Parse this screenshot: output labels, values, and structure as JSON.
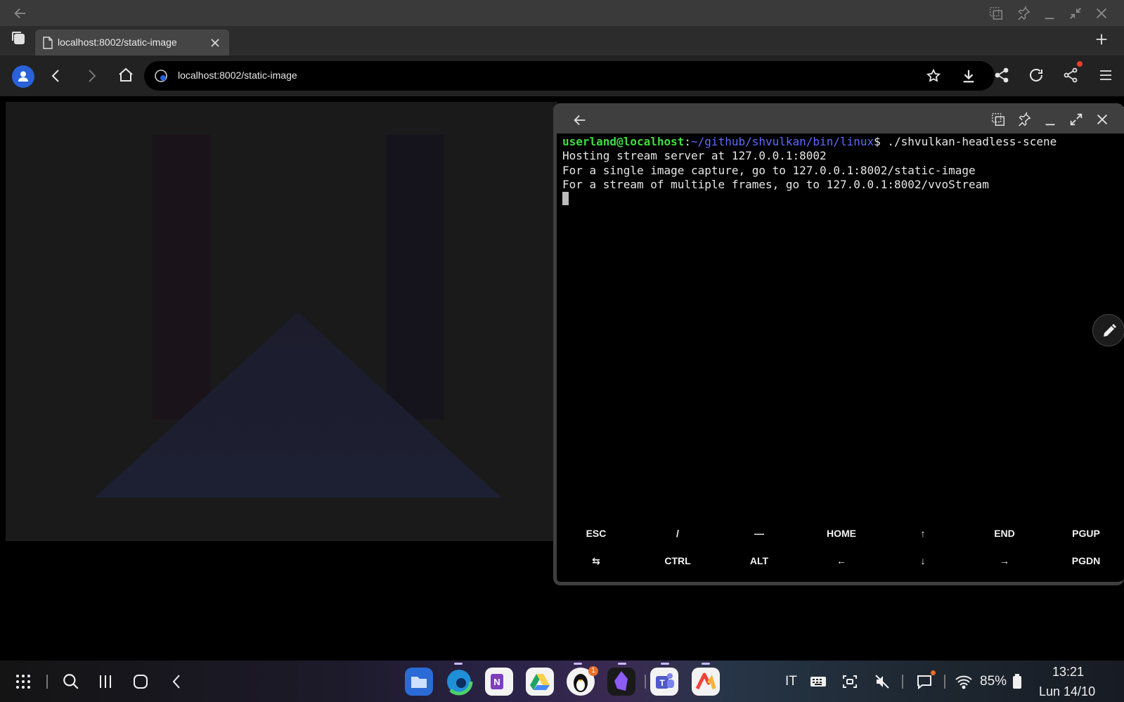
{
  "browser": {
    "tab_title": "localhost:8002/static-image",
    "url": "localhost:8002/static-image"
  },
  "terminal": {
    "prompt_user": "userland@localhost",
    "prompt_path": "~/github/shvulkan/bin/linux",
    "prompt_symbol": "$",
    "command": " ./shvulkan-headless-scene",
    "output": [
      "Hosting stream server at 127.0.0.1:8002",
      "For a single image capture, go to 127.0.0.1:8002/static-image",
      "For a stream of multiple frames, go to 127.0.0.1:8002/vvoStream"
    ],
    "keys_row1": [
      "ESC",
      "/",
      "—",
      "HOME",
      "↑",
      "END",
      "PGUP"
    ],
    "keys_row2": [
      "⇆",
      "CTRL",
      "ALT",
      "←",
      "↓",
      "→",
      "PGDN"
    ]
  },
  "taskbar": {
    "notification_count": "1",
    "language": "IT",
    "battery": "85%",
    "time": "13:21",
    "date": "Lun 14/10"
  },
  "colors": {
    "accent": "#2962d9",
    "prompt_user": "#3fdc3f",
    "prompt_path": "#5e6bff",
    "notification": "#e8402a"
  }
}
